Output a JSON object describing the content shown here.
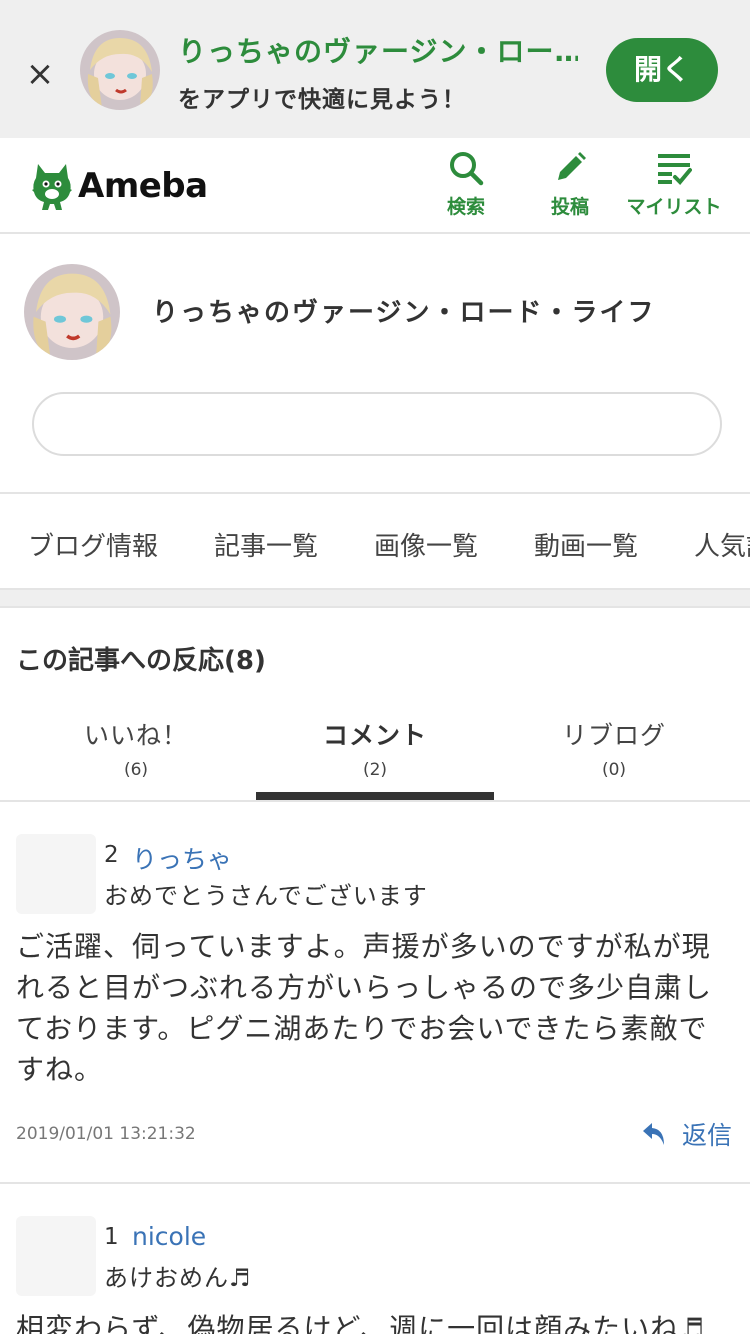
{
  "banner": {
    "title": "りっちゃのヴァージン・ロー…",
    "subtitle": "をアプリで快適に見よう！",
    "open_label": "開く",
    "close_symbol": "×"
  },
  "header": {
    "logo_text": "Ameba",
    "search_label": "検索",
    "post_label": "投稿",
    "mylist_label": "マイリスト",
    "brand_color": "#2d8c3c"
  },
  "profile": {
    "blog_title": "りっちゃのヴァージン・ロード・ライフ"
  },
  "nav": {
    "items": [
      "ブログ情報",
      "記事一覧",
      "画像一覧",
      "動画一覧",
      "人気記"
    ]
  },
  "reactions": {
    "title": "この記事への反応(8)",
    "tabs": [
      {
        "name": "いいね！",
        "count": "(6)"
      },
      {
        "name": "コメント",
        "count": "(2)"
      },
      {
        "name": "リブログ",
        "count": "(0)"
      }
    ],
    "active_tab": "コメント"
  },
  "comments": [
    {
      "number": "2",
      "author": "りっちゃ",
      "subject": "おめでとうさんでございます",
      "body": "ご活躍、伺っていますよ。声援が多いのですが私が現れると目がつぶれる方がいらっしゃるので多少自粛しております。ピグニ湖あたりでお会いできたら素敵ですね。",
      "date": "2019/01/01 13:21:32",
      "reply_label": "返信"
    },
    {
      "number": "1",
      "author": "nicole",
      "subject": "あけおめん♬",
      "body": "相変わらず、偽物居るけど、週に一回は顔みたいね♬"
    }
  ],
  "colors": {
    "accent_green": "#2d8c3c",
    "link_blue": "#3a73b6",
    "banner_bg": "#efefef"
  }
}
